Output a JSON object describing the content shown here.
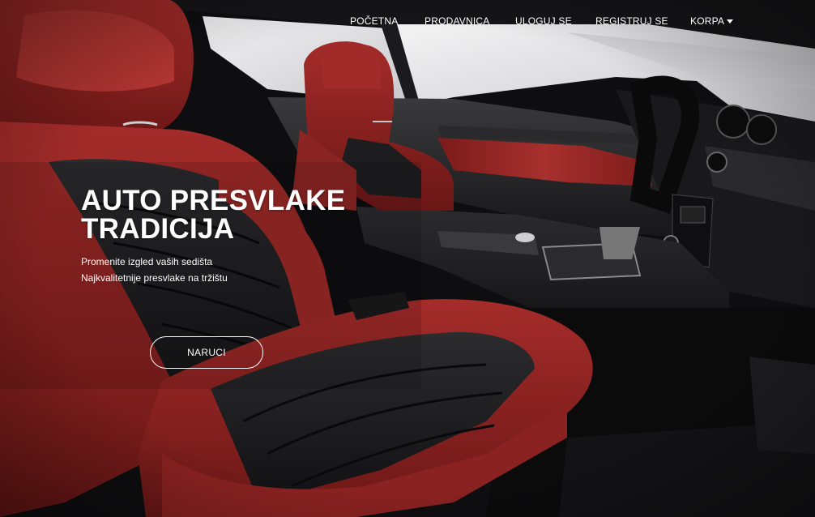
{
  "nav": {
    "items": [
      {
        "label": "POČETNA"
      },
      {
        "label": "PRODAVNICA"
      },
      {
        "label": "ULOGUJ SE"
      },
      {
        "label": "REGISTRUJ SE"
      },
      {
        "label": "KORPA"
      }
    ]
  },
  "hero": {
    "title_line1": "AUTO PRESVLAKE",
    "title_line2": "TRADICIJA",
    "subtitle_line1": "Promenite izgled vaših sedišta",
    "subtitle_line2": "Najkvalitetnije presvlake na tržištu",
    "cta_label": "NARUCI",
    "background_image": "car-interior-red-leather-seats"
  },
  "colors": {
    "leather_red": "#8e2322",
    "leather_black": "#1c1c1e",
    "window_light": "#e4e4e6",
    "text": "#ffffff"
  }
}
